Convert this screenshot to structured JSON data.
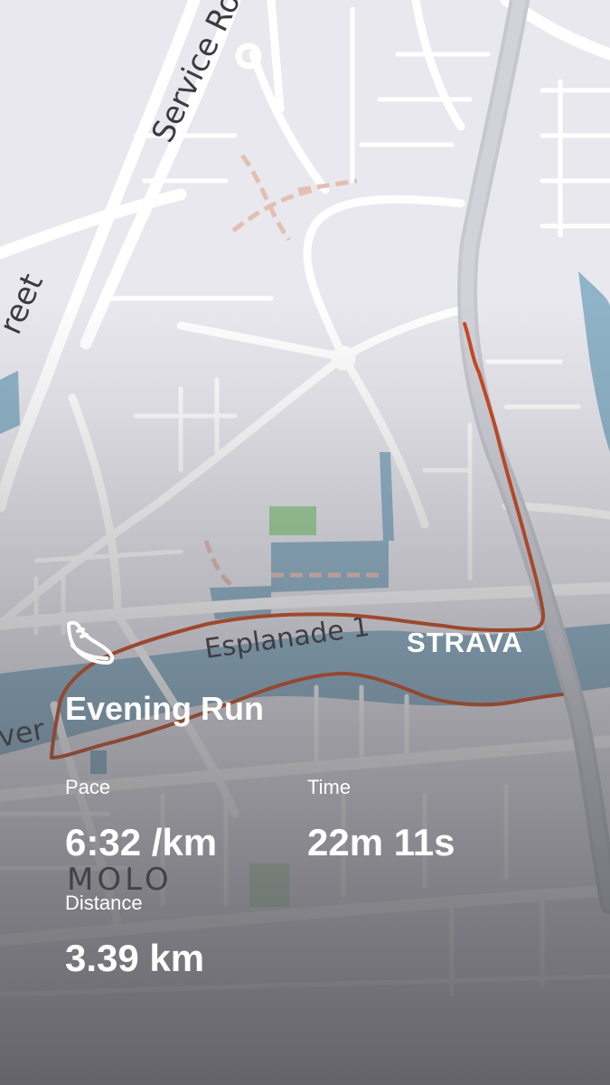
{
  "map": {
    "street_labels": [
      "Service Ro",
      "reet",
      "Esplanade 1",
      "ver",
      "MOLO"
    ],
    "route_color": "#c9491f",
    "water_color": "#8fb3c8",
    "park_color": "#9fd29a"
  },
  "icons": {
    "activity": "running-shoe-icon"
  },
  "brand": {
    "logo_text": "STRAVA"
  },
  "activity": {
    "title": "Evening Run"
  },
  "stats": {
    "pace": {
      "label": "Pace",
      "value": "6:32 /km"
    },
    "time": {
      "label": "Time",
      "value": "22m 11s"
    },
    "distance": {
      "label": "Distance",
      "value": "3.39 km"
    }
  }
}
